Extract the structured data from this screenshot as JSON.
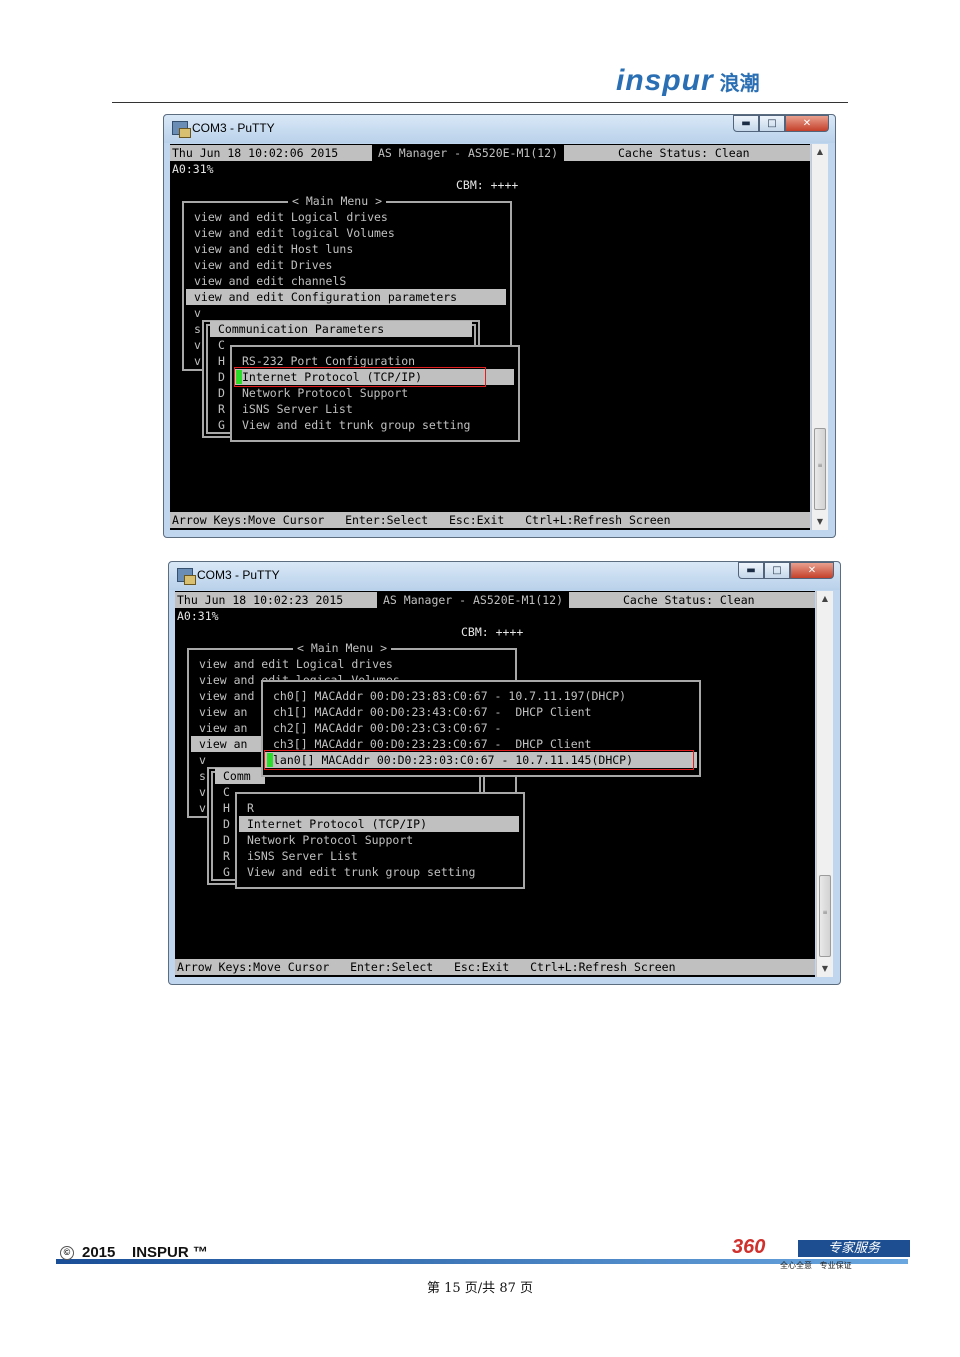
{
  "header": {
    "brand": "inspur",
    "brand_cn": "浪潮"
  },
  "window1": {
    "title": "COM3 - PuTTY",
    "status_time": "Thu Jun 18 10:02:06 2015",
    "status_title": "AS Manager - AS520E-M1(12)",
    "cache_status": "Cache Status: Clean",
    "a0": "A0:31%",
    "cbm": "CBM: ++++",
    "main_menu_title": "< Main Menu >",
    "main_menu": [
      "view and edit Logical drives",
      "view and edit logical Volumes",
      "view and edit Host luns",
      "view and edit Drives",
      "view and edit channelS",
      "view and edit Configuration parameters"
    ],
    "main_menu_partial": [
      "v",
      "s",
      "v",
      "v"
    ],
    "comm_title": "Communication Parameters",
    "comm_letters": [
      "C",
      "H",
      "D",
      "D",
      "R",
      "G"
    ],
    "comm_menu": [
      "RS-232 Port Configuration",
      "Internet Protocol (TCP/IP)",
      "Network Protocol Support",
      "iSNS Server List",
      "View and edit trunk group setting"
    ],
    "help": "Arrow Keys:Move Cursor   Enter:Select   Esc:Exit   Ctrl+L:Refresh Screen"
  },
  "window2": {
    "title": "COM3 - PuTTY",
    "status_time": "Thu Jun 18 10:02:23 2015",
    "status_title": "AS Manager - AS520E-M1(12)",
    "cache_status": "Cache Status: Clean",
    "a0": "A0:31%",
    "cbm": "CBM: ++++",
    "main_menu_title": "< Main Menu >",
    "main_menu": [
      "view and edit Logical drives",
      "view and edit logical Volumes",
      "view and edit Host luns"
    ],
    "main_menu_cut": [
      "view an",
      "view an",
      "view an"
    ],
    "main_menu_partial": [
      "v",
      "s",
      "v",
      "v"
    ],
    "comm_cut": "Comm",
    "comm_letters": [
      "C",
      "H",
      "D",
      "D",
      "R",
      "G"
    ],
    "sub_r": "R",
    "interfaces": [
      "ch0[] MACAddr 00:D0:23:83:C0:67 - 10.7.11.197(DHCP)",
      "ch1[] MACAddr 00:D0:23:43:C0:67 -  DHCP Client",
      "ch2[] MACAddr 00:D0:23:C3:C0:67 -",
      "ch3[] MACAddr 00:D0:23:23:C0:67 -  DHCP Client",
      "lan0[] MACAddr 00:D0:23:03:C0:67 - 10.7.11.145(DHCP)"
    ],
    "comm_menu": [
      "Internet Protocol (TCP/IP)",
      "Network Protocol Support",
      "iSNS Server List",
      "View and edit trunk group setting"
    ],
    "help": "Arrow Keys:Move Cursor   Enter:Select   Esc:Exit   Ctrl+L:Refresh Screen"
  },
  "footer": {
    "copyright_symbol": "©",
    "copyright": "2015    INSPUR ™",
    "badge_num": "360",
    "badge_service": "专家服务",
    "badge_tagline": "全心全意   专业保证",
    "page": "第 15 页/共 87 页"
  }
}
